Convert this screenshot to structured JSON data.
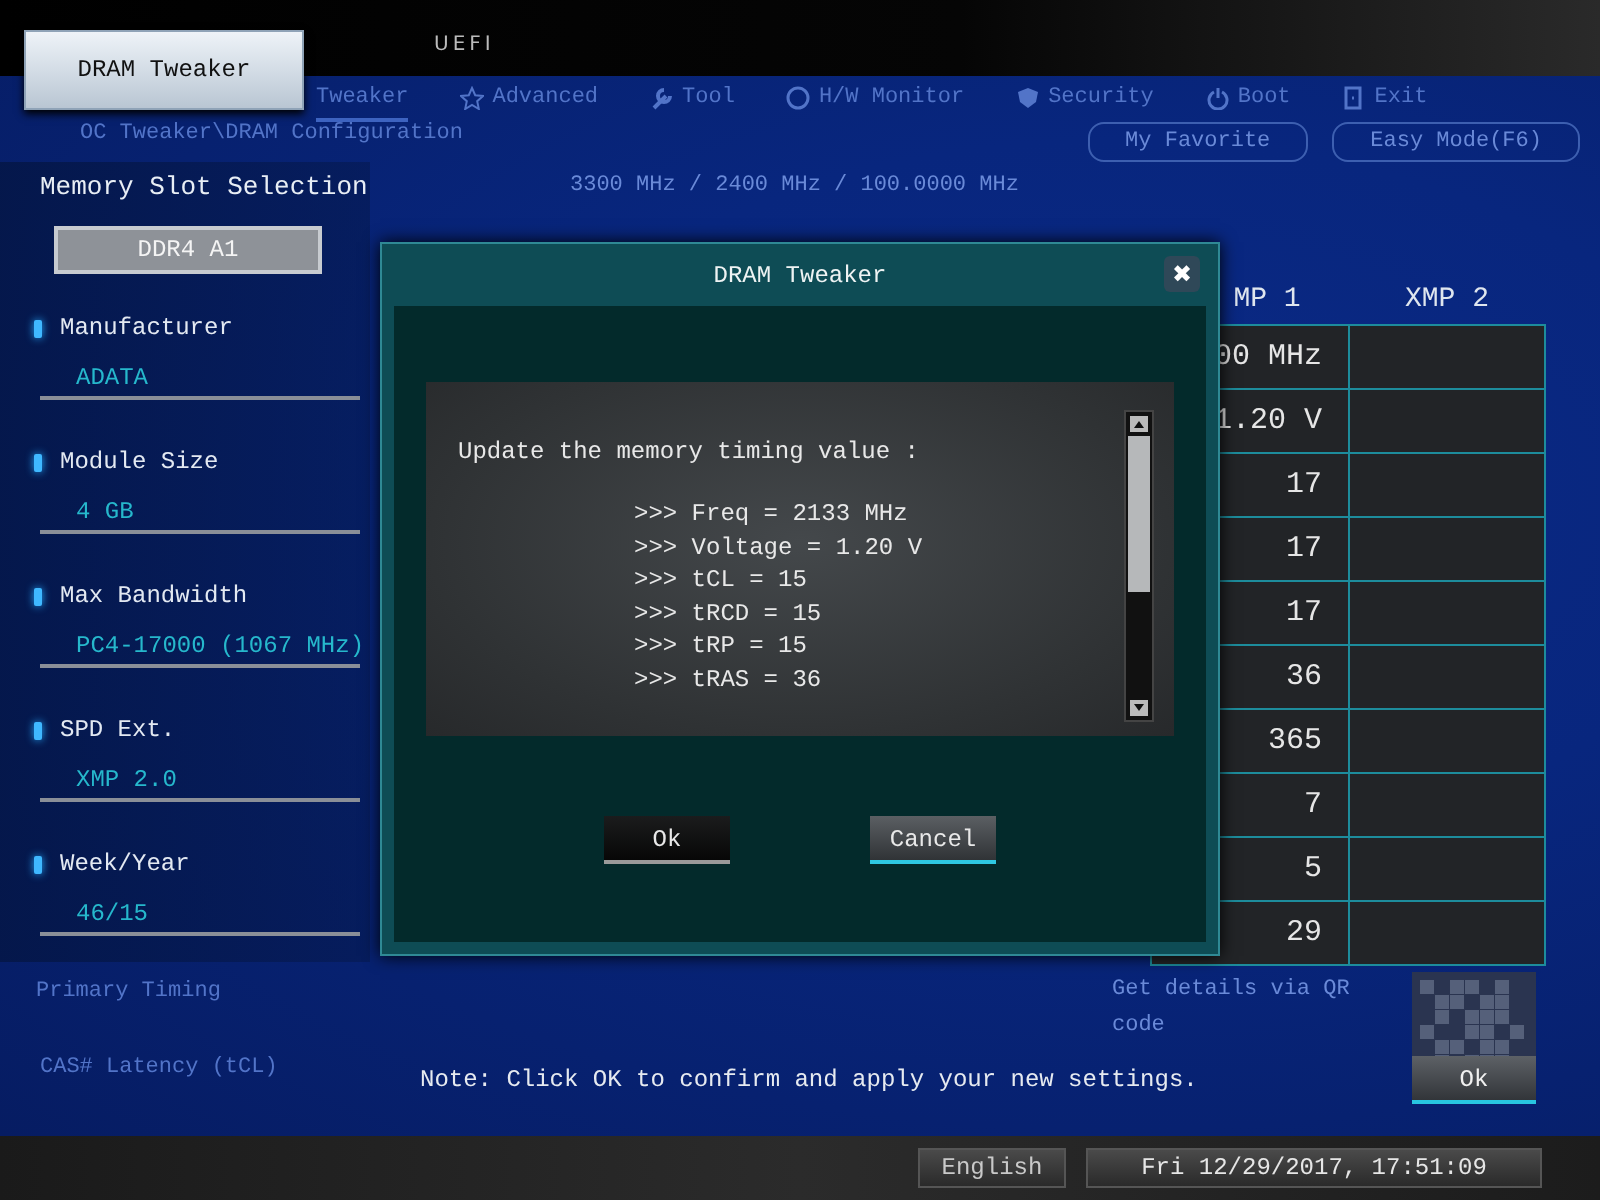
{
  "header": {
    "product": "UEFI",
    "page_tab": "DRAM Tweaker"
  },
  "background": {
    "nav_tabs": [
      {
        "label": "Tweaker",
        "selected": true
      },
      {
        "label": "Advanced",
        "selected": false
      },
      {
        "label": "Tool",
        "selected": false
      },
      {
        "label": "H/W Monitor",
        "selected": false
      },
      {
        "label": "Security",
        "selected": false
      },
      {
        "label": "Boot",
        "selected": false
      },
      {
        "label": "Exit",
        "selected": false
      }
    ],
    "breadcrumb": "OC Tweaker\\DRAM Configuration",
    "favorite_button": "My Favorite",
    "easy_mode_button": "Easy Mode(F6)",
    "speed_reading": "3300 MHz / 2400 MHz / 100.0000 MHz",
    "primary_timing": "Primary Timing",
    "cas_latency": "CAS# Latency (tCL)",
    "qr_hint": "Get details via QR code"
  },
  "memory_panel": {
    "title": "Memory Slot Selection",
    "slot": "DDR4 A1",
    "fields": [
      {
        "label": "Manufacturer",
        "value": "ADATA"
      },
      {
        "label": "Module Size",
        "value": "4 GB"
      },
      {
        "label": "Max Bandwidth",
        "value": "PC4-17000 (1067 MHz)"
      },
      {
        "label": "SPD Ext.",
        "value": "XMP 2.0"
      },
      {
        "label": "Week/Year",
        "value": "46/15"
      }
    ]
  },
  "table": {
    "columns": [
      "MP 1",
      "XMP 2"
    ],
    "rows": [
      {
        "column_1": "00 MHz"
      },
      {
        "column_1": "1.20 V"
      },
      {
        "column_1": "17"
      },
      {
        "column_1": "17"
      },
      {
        "column_1": "17"
      },
      {
        "column_1": "36"
      },
      {
        "column_1": "365"
      },
      {
        "column_1": "7"
      },
      {
        "column_1": "5"
      },
      {
        "column_1": "29"
      }
    ]
  },
  "dialog": {
    "title": "DRAM Tweaker",
    "close": "✖",
    "message": "Update the memory timing value :",
    "lines": [
      ">>> Freq = 2133 MHz",
      ">>> Voltage = 1.20 V",
      ">>> tCL = 15",
      ">>> tRCD = 15",
      ">>> tRP = 15",
      ">>> tRAS = 36"
    ],
    "buttons": [
      {
        "label": "Ok",
        "selected": false
      },
      {
        "label": "Cancel",
        "selected": true
      }
    ]
  },
  "note": "Note: Click OK to confirm and apply your new settings.",
  "ok_button": "Ok",
  "status_bar": {
    "language": "English",
    "datetime": "Fri 12/29/2017, 17:51:09"
  }
}
